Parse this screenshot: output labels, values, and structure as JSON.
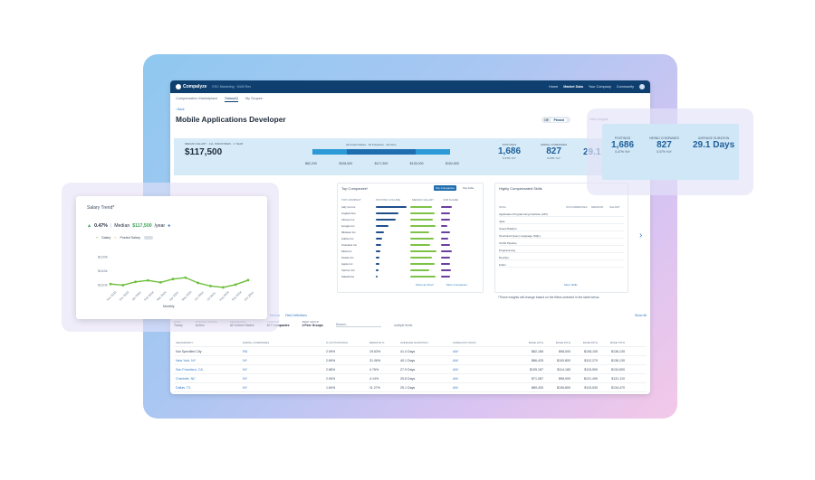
{
  "app": {
    "logo": "Compalyze",
    "crumb": "ESC Marketing · 5440 Rev",
    "nav": [
      "Home",
      "Market Data",
      "Your Company",
      "Community"
    ],
    "nav_active": "Market Data"
  },
  "tabs": [
    "Compensation Marketplace",
    "SalaryIQ",
    "My Scopes"
  ],
  "tab_active": "SalaryIQ",
  "back": "‹ Back",
  "page_title": "Mobile Applications Developer",
  "toggle": {
    "off": "Off",
    "on": "Pinned"
  },
  "hide_insights": "Hide insights",
  "band": {
    "salary_label": "MEDIAN SALARY · ALL INDUSTRIES · 1 YEAR",
    "salary": "$117,500",
    "bar_label": "All United States · All Industries · All sizes",
    "ticks": [
      "$82,200",
      "$108,500",
      "$117,500",
      "$135,000",
      "$152,800"
    ],
    "postings_label": "POSTINGS",
    "postings": "1,686",
    "postings_delta": "0.47% YoY",
    "companies_label": "HIRING COMPANIES",
    "companies": "827",
    "companies_delta": "0.07% YoY",
    "days_partial": "29.1"
  },
  "salary_trend": {
    "title": "Salary Trend*",
    "pct": "0.47%",
    "median_label": "Median",
    "median": "$117,500",
    "per": "/year",
    "legend_salary": "Salary",
    "legend_posted": "Posted Salary",
    "y_ticks": [
      "$120k",
      "$115k",
      "$110k"
    ],
    "x_ticks": [
      "Nov 2023",
      "Dec 2023",
      "Jan 2024",
      "Feb 2024",
      "Mar 2024",
      "Apr 2024",
      "May 2024",
      "Jun 2024",
      "Jul 2024",
      "Aug 2024",
      "Sep 2024",
      "Oct 2024"
    ],
    "x_label": "Monthly"
  },
  "chart_data": {
    "type": "line",
    "title": "Salary Trend*",
    "x": [
      "Nov 2023",
      "Dec 2023",
      "Jan 2024",
      "Feb 2024",
      "Mar 2024",
      "Apr 2024",
      "May 2024",
      "Jun 2024",
      "Jul 2024",
      "Aug 2024",
      "Sep 2024",
      "Oct 2024"
    ],
    "series": [
      {
        "name": "Salary",
        "values": [
          110.2,
          109.8,
          111.0,
          111.5,
          110.8,
          112.0,
          112.5,
          110.6,
          109.5,
          109.0,
          110.0,
          111.6
        ]
      }
    ],
    "ylim": [
      108,
      121
    ],
    "ylabel": "",
    "xlabel": "Monthly",
    "color": "#6cbf3a"
  },
  "top_companies": {
    "title": "Top Companies*",
    "btn_companies": "Top Companies",
    "btn_jobs": "Top Jobs",
    "headers": [
      "TOP COMPANY",
      "POSTING VOLUME",
      "MEDIAN SALARY",
      "JOB SHARE"
    ],
    "rows": [
      {
        "name": "Indy Go Inc",
        "vol": 0.95,
        "sal": 0.8,
        "share": 0.35
      },
      {
        "name": "Capital One",
        "vol": 0.7,
        "sal": 0.9,
        "share": 0.3
      },
      {
        "name": "Infosys Inc",
        "vol": 0.6,
        "sal": 0.85,
        "share": 0.28
      },
      {
        "name": "Google Inc",
        "vol": 0.4,
        "sal": 0.95,
        "share": 0.22
      },
      {
        "name": "Midwest Inc",
        "vol": 0.25,
        "sal": 0.7,
        "share": 0.3
      },
      {
        "name": "Adobe Inc",
        "vol": 0.2,
        "sal": 0.88,
        "share": 0.25
      },
      {
        "name": "Cloudera Inc",
        "vol": 0.18,
        "sal": 0.75,
        "share": 0.3
      },
      {
        "name": "Meta Inc",
        "vol": 0.15,
        "sal": 0.98,
        "share": 0.35
      },
      {
        "name": "Oracle Inc",
        "vol": 0.12,
        "sal": 0.8,
        "share": 0.3
      },
      {
        "name": "Apple Inc",
        "vol": 0.1,
        "sal": 0.9,
        "share": 0.28
      },
      {
        "name": "Verizon Inc",
        "vol": 0.08,
        "sal": 0.7,
        "share": 0.32
      },
      {
        "name": "Salesforce",
        "vol": 0.06,
        "sal": 0.92,
        "share": 0.3
      }
    ],
    "footer_left": "Show as Chart",
    "footer_right": "More Companies"
  },
  "skills": {
    "title": "Highly Compensated Skills",
    "headers": [
      "SKILL",
      "OCCURRENCES",
      "DEMAND",
      "SALARY"
    ],
    "rows": [
      "Application Programming Interface (API)",
      "Java",
      "Cloud Platform",
      "Structured Query Language (SQL)",
      "CI/CD Pipeline",
      "Programming",
      "DevOps",
      "Kotlin"
    ],
    "footer": "More Skills"
  },
  "footnote": "*These insights will change based on the filters selected in the table below.",
  "filters": {
    "tabs": [
      "All Results",
      "Posting View",
      "Granular Action",
      "Company View"
    ],
    "links": [
      "Median",
      "Field Definitions"
    ],
    "date_label": "DATE",
    "date": "Today",
    "status_label": "POSTING STATUS",
    "status": "Active",
    "geo_label": "GEOGRAPHY",
    "geo": "All United States",
    "company_label": "COMPANY",
    "company": "827 Companies",
    "peer_label": "PEER GROUP",
    "peer": "4 Peer Groups",
    "search": "Search...",
    "multiple": "multiple fields",
    "show_all": "Show All"
  },
  "grid": {
    "headers": [
      "GEOGRAPHY",
      "HIRING COMPANIES",
      "% OF POSTINGS",
      "REMOTE %",
      "AVERAGE DURATION",
      "FORECAST (MVP)",
      "BASE 10TH",
      "BASE 25TH",
      "BASE 50TH",
      "BASE 75TH"
    ],
    "rows": [
      {
        "geo": "Not Specified City",
        "companies": "FAI",
        "pct": "2.99%",
        "remote": "19.63%",
        "dur": "41.4 Days",
        "fc": "ΔW",
        "b10": "$82,185",
        "b25": "$98,000",
        "b50": "$108,105",
        "b75": "$136,130"
      },
      {
        "geo": "New York, NY",
        "companies": "NY",
        "pct": "2.89%",
        "remote": "31.06%",
        "dur": "40.1 Days",
        "fc": "ΔW",
        "b10": "$86,425",
        "b25": "$100,800",
        "b50": "$112,270",
        "b75": "$136,130"
      },
      {
        "geo": "San Francisco, CA",
        "companies": "NY",
        "pct": "2.88%",
        "remote": "4.76%",
        "dur": "27.9 Days",
        "fc": "ΔW",
        "b10": "$105,187",
        "b25": "$114,180",
        "b50": "$115,590",
        "b75": "$134,500"
      },
      {
        "geo": "Charlotte, NC",
        "companies": "NY",
        "pct": "2.06%",
        "remote": "4.14%",
        "dur": "25.8 Days",
        "fc": "ΔW",
        "b10": "$71,087",
        "b25": "$98,000",
        "b50": "$121,490",
        "b75": "$131,110"
      },
      {
        "geo": "Dallas, TX",
        "companies": "NY",
        "pct": "1.84%",
        "remote": "11.27%",
        "dur": "25.1 Days",
        "fc": "ΔW",
        "b10": "$89,430",
        "b25": "$106,800",
        "b50": "$115,530",
        "b75": "$134,470"
      }
    ]
  },
  "right_card": {
    "postings_label": "POSTINGS",
    "postings": "1,686",
    "postings_delta": "0.47% YoY",
    "companies_label": "HIRING COMPANIES",
    "companies": "827",
    "companies_delta": "0.07% YoY",
    "days_label": "AVERAGE DURATION",
    "days": "29.1 Days"
  }
}
